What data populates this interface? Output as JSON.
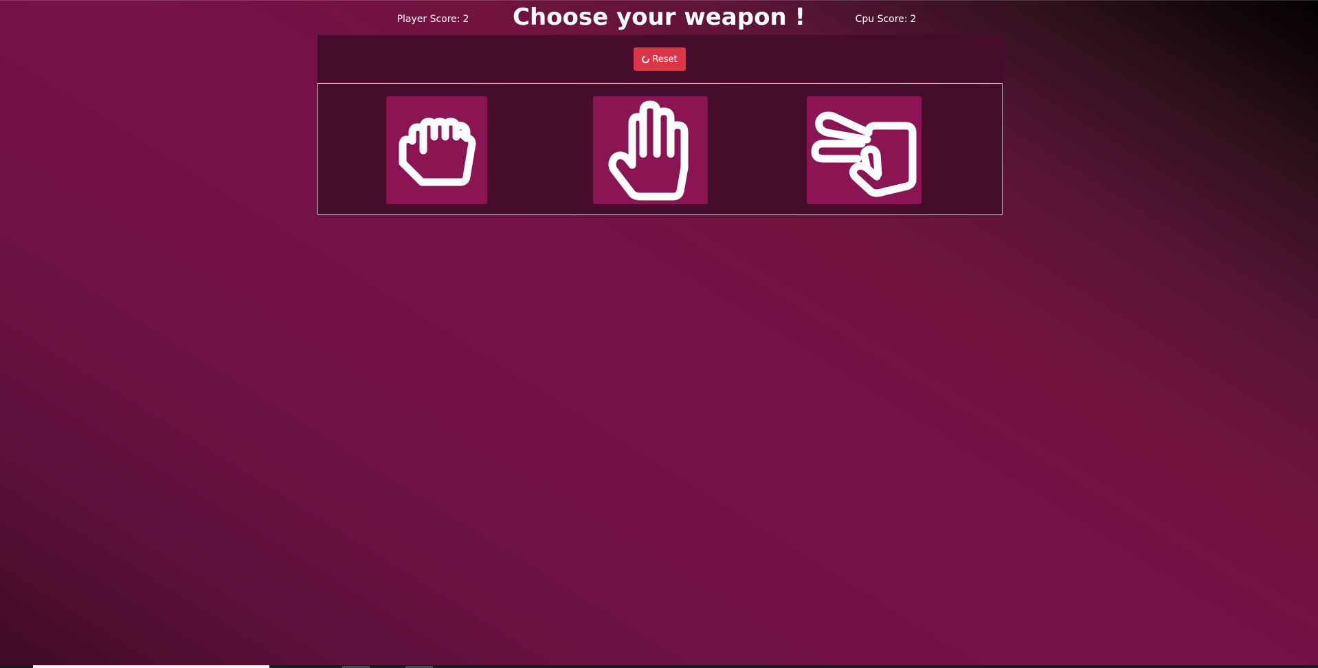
{
  "page": {
    "title": "Choose your weapon !"
  },
  "scoreboard": {
    "player_label": "Player Score:",
    "player_score": "2",
    "cpu_label": "Cpu Score:",
    "cpu_score": "2",
    "reset_label": "Reset",
    "reset_icon": "refresh-circle-icon"
  },
  "weapons": [
    {
      "name": "Rock",
      "icon": "fist-icon"
    },
    {
      "name": "Paper",
      "icon": "open-hand-icon"
    },
    {
      "name": "Scissors",
      "icon": "scissors-hand-icon"
    }
  ],
  "colors": {
    "panel": "#460c2b",
    "tile": "#8b1553",
    "reset": "#dc3545",
    "text": "#ffffff"
  }
}
